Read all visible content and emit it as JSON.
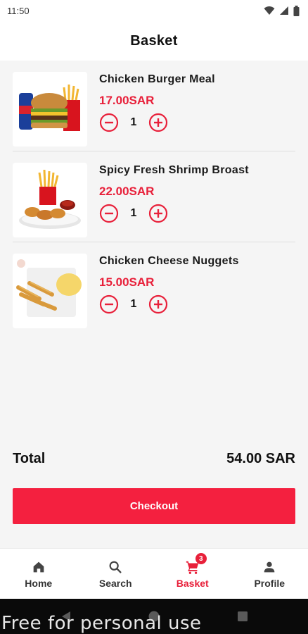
{
  "status": {
    "time": "11:50"
  },
  "header": {
    "title": "Basket"
  },
  "items": [
    {
      "name": "Chicken Burger Meal",
      "price": "17.00SAR",
      "qty": "1"
    },
    {
      "name": "Spicy Fresh Shrimp Broast",
      "price": "22.00SAR",
      "qty": "1"
    },
    {
      "name": "Chicken Cheese Nuggets",
      "price": "15.00SAR",
      "qty": "1"
    }
  ],
  "total": {
    "label": "Total",
    "value": "54.00 SAR"
  },
  "checkout": {
    "label": "Checkout"
  },
  "nav": {
    "items": [
      {
        "label": "Home",
        "icon": "home-icon"
      },
      {
        "label": "Search",
        "icon": "search-icon"
      },
      {
        "label": "Basket",
        "icon": "cart-icon",
        "badge": "3"
      },
      {
        "label": "Profile",
        "icon": "person-icon"
      }
    ]
  },
  "watermark": "Free for personal use",
  "colors": {
    "accent": "#e8203a",
    "button": "#f4203f",
    "background": "#f5f5f5"
  }
}
